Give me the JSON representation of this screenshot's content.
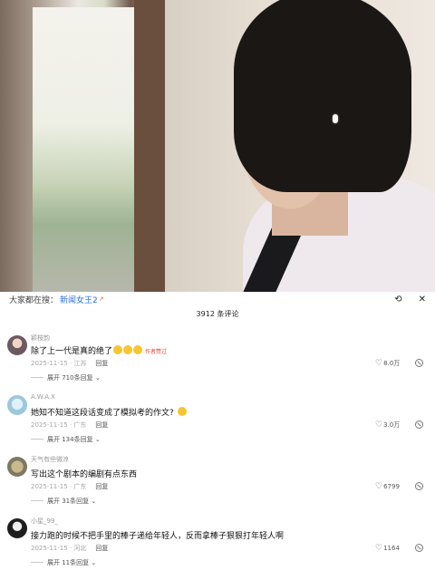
{
  "search": {
    "label": "大家都在搜：",
    "term": "新闻女王2",
    "trend_mark": "↗",
    "refresh_icon": "refresh-icon",
    "close_icon": "close-icon"
  },
  "comment_count": "3912 条评论",
  "colors": {
    "link": "#2d6fe0",
    "tag": "#e34a3c",
    "emoji": "#f7c531"
  },
  "comments": [
    {
      "username": "颖桉韵",
      "text": "除了上一代是真的绝了",
      "tag": "作者赞过",
      "date_location": "2025-11-15 · 江苏",
      "reply": "回复",
      "expand": "展开 710条回复",
      "likes": "8.0万"
    },
    {
      "username": "A.W.A.X",
      "text": "她知不知道这段话变成了模拟考的作文?",
      "date_location": "2025-11-15 · 广东",
      "reply": "回复",
      "expand": "展开 134条回复",
      "likes": "3.0万"
    },
    {
      "username": "天气有些微凉",
      "text": "写出这个剧本的编剧有点东西",
      "date_location": "2025-11-15 · 广东",
      "reply": "回复",
      "expand": "展开 31条回复",
      "likes": "6799"
    },
    {
      "username": "小星_99_",
      "text": "接力跑的时候不把手里的棒子递给年轻人，反而拿棒子狠狠打年轻人啊",
      "date_location": "2025-11-15 · 河北",
      "reply": "回复",
      "expand": "展开 11条回复",
      "likes": "1164"
    }
  ]
}
